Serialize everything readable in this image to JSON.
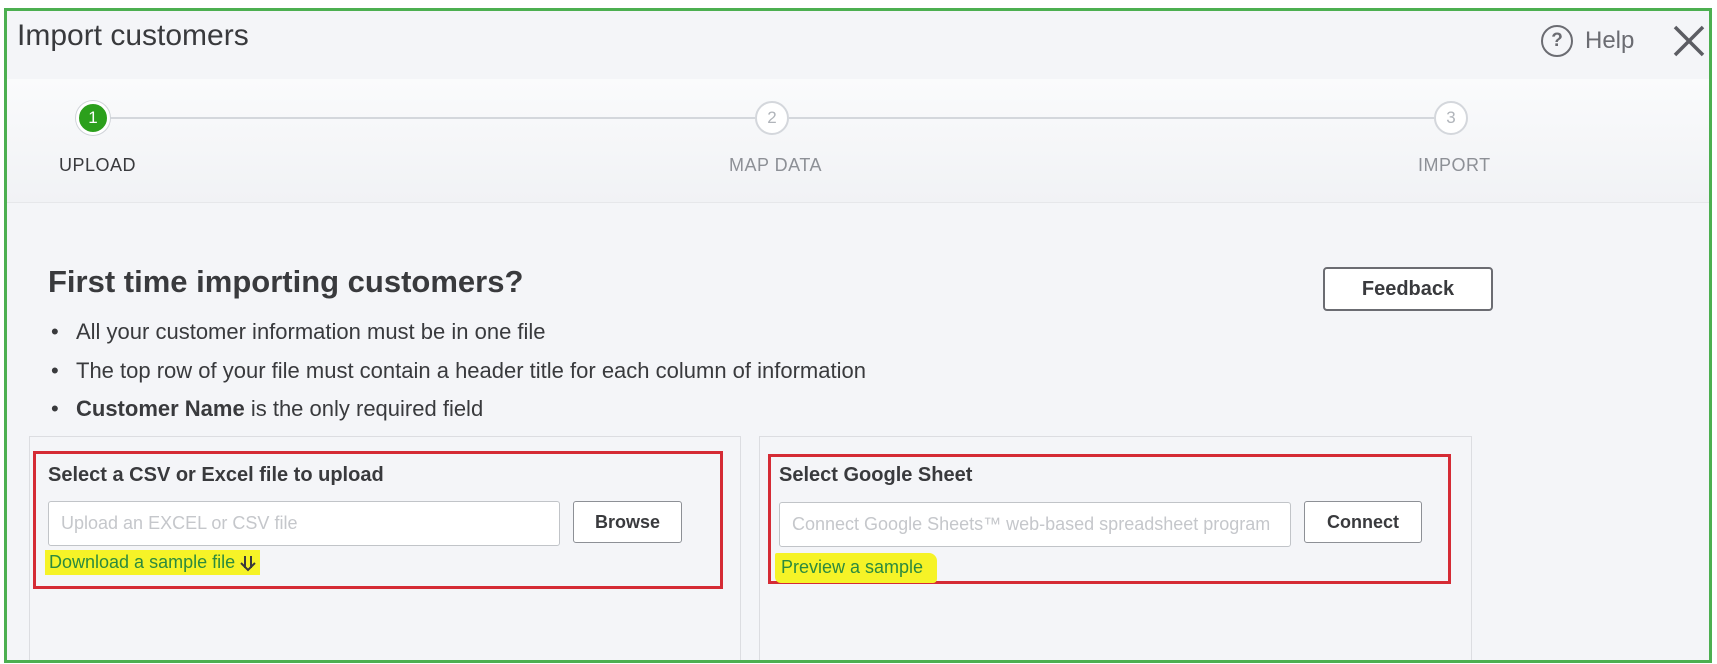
{
  "dialog": {
    "title": "Import customers",
    "help_label": "Help"
  },
  "stepper": {
    "steps": [
      {
        "number": "1",
        "label": "UPLOAD",
        "active": true
      },
      {
        "number": "2",
        "label": "MAP DATA",
        "active": false
      },
      {
        "number": "3",
        "label": "IMPORT",
        "active": false
      }
    ]
  },
  "intro": {
    "heading": "First time importing customers?",
    "feedback_label": "Feedback",
    "bullet1": "All your customer information must be in one file",
    "bullet2": "The top row of your file must contain a header title for each column of information",
    "bullet3_bold": "Customer Name",
    "bullet3_rest": " is the only required field"
  },
  "upload": {
    "title": "Select a CSV or Excel file to upload",
    "placeholder": "Upload an EXCEL or CSV file",
    "browse_label": "Browse",
    "download_link": "Download a sample file"
  },
  "google": {
    "title": "Select Google Sheet",
    "placeholder": "Connect Google Sheets™ web-based spreadsheet program",
    "connect_label": "Connect",
    "preview_link": "Preview a sample"
  },
  "colors": {
    "active_step": "#2ca01c",
    "frame_outline": "#4caf50",
    "annotation_box": "#d52b35",
    "highlight": "#f6f327",
    "link": "#2c8a3e"
  },
  "icons": [
    "help-circle-icon",
    "close-icon",
    "download-arrow-icon"
  ]
}
